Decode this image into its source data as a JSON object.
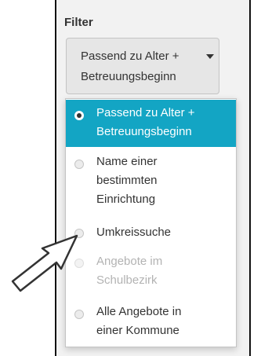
{
  "filter": {
    "title": "Filter",
    "selected_line1": "Passend zu Alter +",
    "selected_line2": "Betreuungsbeginn",
    "options": [
      {
        "lines": [
          "Passend zu Alter +",
          "Betreuungsbeginn"
        ],
        "selected": true,
        "disabled": false
      },
      {
        "lines": [
          "Name einer",
          "bestimmten",
          "Einrichtung"
        ],
        "selected": false,
        "disabled": false
      },
      {
        "lines": [
          "Umkreissuche"
        ],
        "selected": false,
        "disabled": false
      },
      {
        "lines": [
          "Angebote im",
          "Schulbezirk"
        ],
        "selected": false,
        "disabled": true
      },
      {
        "lines": [
          "Alle Angebote in",
          "einer Kommune"
        ],
        "selected": false,
        "disabled": false
      }
    ]
  },
  "colors": {
    "accent": "#13a5c4",
    "panel_bg": "#f2f2f2"
  },
  "icons": {
    "caret": "caret-down-icon",
    "pointer": "pointer-arrow-icon"
  }
}
